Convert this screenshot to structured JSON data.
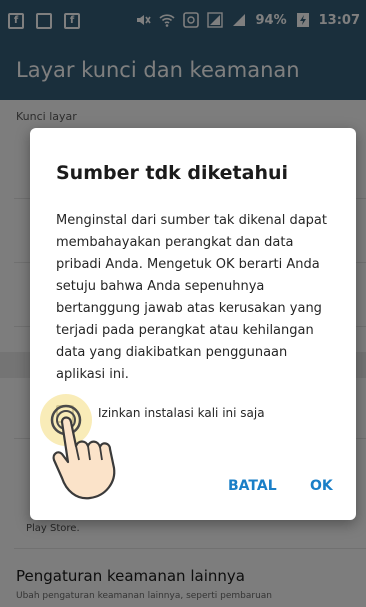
{
  "status_bar": {
    "left_icons": [
      "facebook-icon",
      "gallery-icon",
      "facebook-icon"
    ],
    "battery_text": "94%",
    "time": "13:07"
  },
  "app_bar": {
    "title": "Layar kunci dan keamanan"
  },
  "background": {
    "section_header": "Kunci layar",
    "play_store_text": "Play Store.",
    "more_security_title": "Pengaturan keamanan lainnya",
    "more_security_sub": "Ubah pengaturan keamanan lainnya, seperti pembaruan"
  },
  "dialog": {
    "title": "Sumber tdk diketahui",
    "message": "Menginstal dari sumber tak dikenal dapat membahayakan perangkat dan data pribadi Anda. Mengetuk OK berarti Anda setuju bahwa Anda sepenuhnya bertanggung jawab atas kerusakan yang terjadi pada perangkat atau kehilangan data yang diakibatkan penggunaan aplikasi ini.",
    "checkbox_label": "Izinkan instalasi kali ini saja",
    "checkbox_checked": false,
    "cancel_label": "BATAL",
    "ok_label": "OK"
  },
  "colors": {
    "app_bar": "#355f78",
    "accent": "#1a7fc7"
  }
}
